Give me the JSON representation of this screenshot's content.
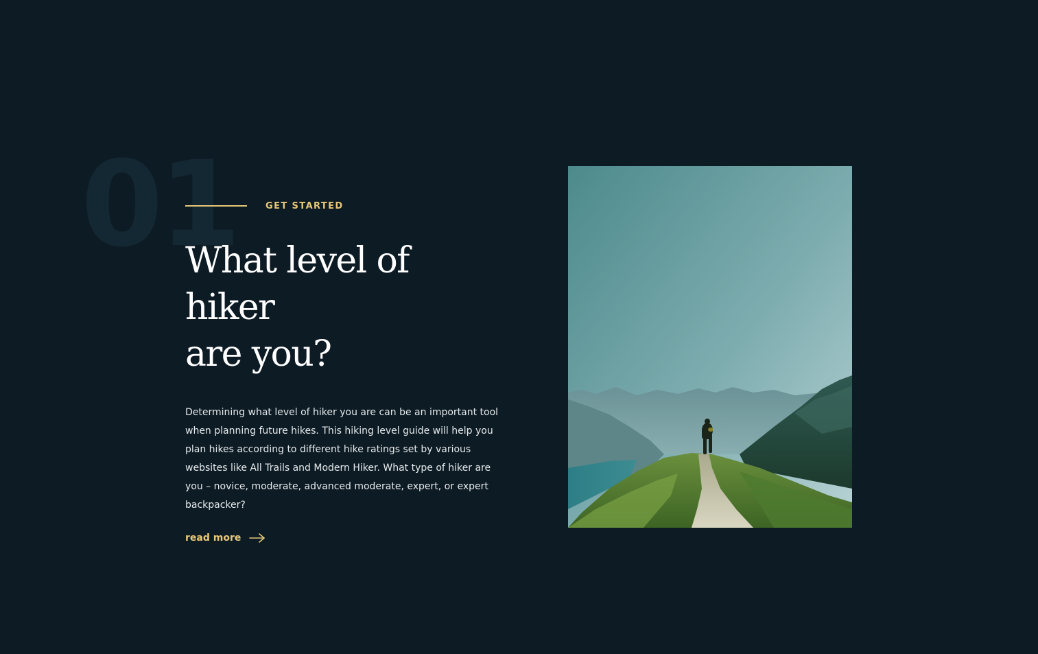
{
  "section": {
    "number": "01",
    "eyebrow": "GET STARTED",
    "headline_line1": "What level of hiker",
    "headline_line2": "are you?",
    "body": "Determining what level of hiker you are can be an important tool when planning future hikes. This hiking level guide will help you plan hikes according to different hike ratings set by various websites like All Trails and Modern Hiker. What type of hiker are you – novice, moderate, advanced moderate, expert, or expert backpacker?",
    "read_more": "read more",
    "arrow_icon": "arrow-right-icon"
  },
  "colors": {
    "background": "#0d1b24",
    "accent": "#e8c777",
    "number_watermark": "#142833",
    "heading": "#ffffff",
    "body_text": "#e6eaec"
  },
  "image": {
    "subject": "hiker-on-mountain-ridge-photo"
  }
}
